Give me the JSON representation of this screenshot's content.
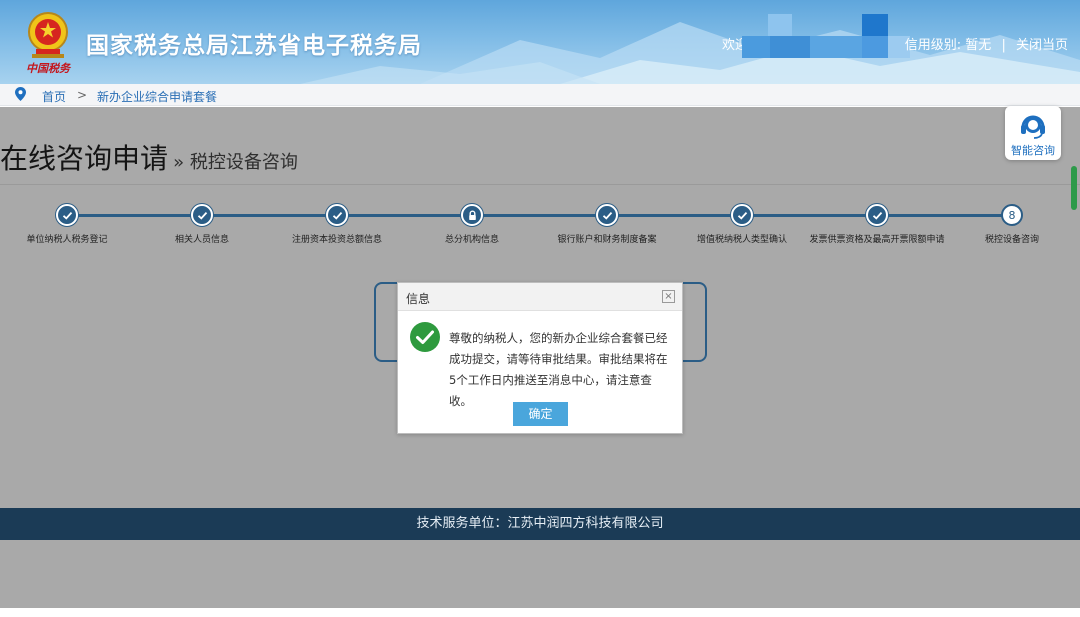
{
  "header": {
    "site_title": "国家税务总局江苏省电子税务局",
    "slogan": "中国税务",
    "welcome": "欢迎",
    "credit_label": "信用级别:",
    "credit_value": "暂无",
    "separator": "|",
    "close_page": "关闭当页"
  },
  "breadcrumb": {
    "home": "首页",
    "separator": ">",
    "current": "新办企业综合申请套餐"
  },
  "page": {
    "title": "在线咨询申请",
    "subtitle": "» 税控设备咨询"
  },
  "steps": [
    {
      "label": "单位纳税人税务登记",
      "state": "done"
    },
    {
      "label": "相关人员信息",
      "state": "done"
    },
    {
      "label": "注册资本投资总额信息",
      "state": "done"
    },
    {
      "label": "总分机构信息",
      "state": "locked"
    },
    {
      "label": "银行账户和财务制度备案",
      "state": "done"
    },
    {
      "label": "增值税纳税人类型确认",
      "state": "done"
    },
    {
      "label": "发票供票资格及最高开票限额申请",
      "state": "done"
    },
    {
      "label": "税控设备咨询",
      "state": "current",
      "number": "8"
    }
  ],
  "dialog": {
    "title": "信息",
    "close_glyph": "×",
    "message": "尊敬的纳税人，您的新办企业综合套餐已经成功提交，请等待审批结果。审批结果将在5个工作日内推送至消息中心，请注意查收。",
    "ok_label": "确定"
  },
  "smart_help": {
    "label": "智能咨询"
  },
  "footer": {
    "text": "技术服务单位：江苏中润四方科技有限公司"
  },
  "colors": {
    "header_blue": "#5fa6dc",
    "step_blue": "#2b5d86",
    "ok_button": "#4aa6dc",
    "success_green": "#2e9a3e",
    "footer_navy": "#1b3b56",
    "overlay_gray": "#a9a9a9"
  },
  "icons": {
    "emblem": "national-emblem-icon",
    "location": "location-pin-icon",
    "check": "check-icon",
    "lock": "lock-icon",
    "success": "success-check-icon",
    "close": "close-icon",
    "headset": "headset-icon"
  }
}
